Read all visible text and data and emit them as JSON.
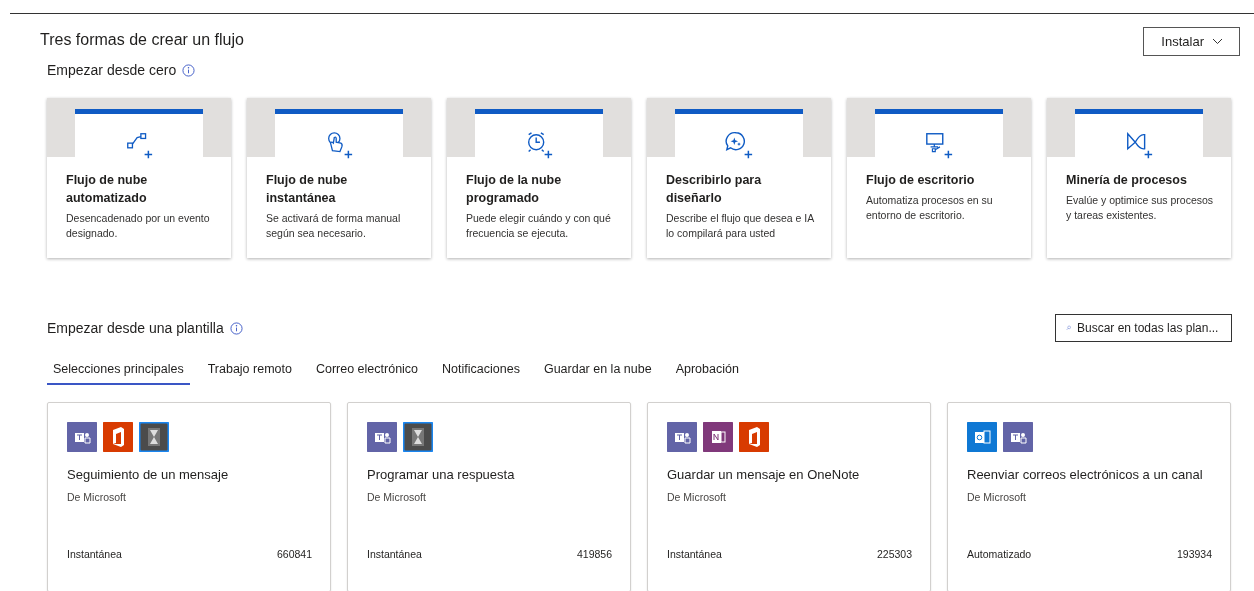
{
  "title": "Tres formas de crear un flujo",
  "install_button": {
    "label": "Instalar"
  },
  "blank_section": {
    "heading": "Empezar desde cero",
    "cards": [
      {
        "kind": "automated",
        "title": "Flujo de nube automatizado",
        "description": "Desencadenado por un evento designado."
      },
      {
        "kind": "instant",
        "title": "Flujo de nube instantánea",
        "description": "Se activará de forma manual según sea necesario."
      },
      {
        "kind": "scheduled",
        "title": "Flujo de la nube programado",
        "description": "Puede elegir cuándo y con qué frecuencia se ejecuta."
      },
      {
        "kind": "describe",
        "title": "Describirlo para diseñarlo",
        "description": "Describe el flujo que desea e IA lo compilará para usted"
      },
      {
        "kind": "desktop",
        "title": "Flujo de escritorio",
        "description": "Automatiza procesos en su entorno de escritorio."
      },
      {
        "kind": "mining",
        "title": "Minería de procesos",
        "description": "Evalúe y optimice sus procesos y tareas existentes."
      }
    ]
  },
  "template_section": {
    "heading": "Empezar desde una plantilla",
    "search": {
      "placeholder": "Buscar en todas las plan..."
    },
    "tabs": [
      {
        "label": "Selecciones principales",
        "selected": true
      },
      {
        "label": "Trabajo remoto",
        "selected": false
      },
      {
        "label": "Correo electrónico",
        "selected": false
      },
      {
        "label": "Notificaciones",
        "selected": false
      },
      {
        "label": "Guardar en la nube",
        "selected": false
      },
      {
        "label": "Aprobación",
        "selected": false
      }
    ],
    "templates": [
      {
        "connectors": [
          {
            "kind": "teams"
          },
          {
            "kind": "office"
          },
          {
            "kind": "delay"
          }
        ],
        "title": "Seguimiento de un mensaje",
        "publisher": "De Microsoft",
        "type": "Instantánea",
        "count": "660841"
      },
      {
        "connectors": [
          {
            "kind": "teams"
          },
          {
            "kind": "delay"
          }
        ],
        "title": "Programar una respuesta",
        "publisher": "De Microsoft",
        "type": "Instantánea",
        "count": "419856"
      },
      {
        "connectors": [
          {
            "kind": "teams"
          },
          {
            "kind": "onenote"
          },
          {
            "kind": "office"
          }
        ],
        "title": "Guardar un mensaje en OneNote",
        "publisher": "De Microsoft",
        "type": "Instantánea",
        "count": "225303"
      },
      {
        "connectors": [
          {
            "kind": "outlook"
          },
          {
            "kind": "teams"
          }
        ],
        "title": "Reenviar correos electrónicos a un canal",
        "publisher": "De Microsoft",
        "type": "Automatizado",
        "count": "193934"
      }
    ]
  }
}
